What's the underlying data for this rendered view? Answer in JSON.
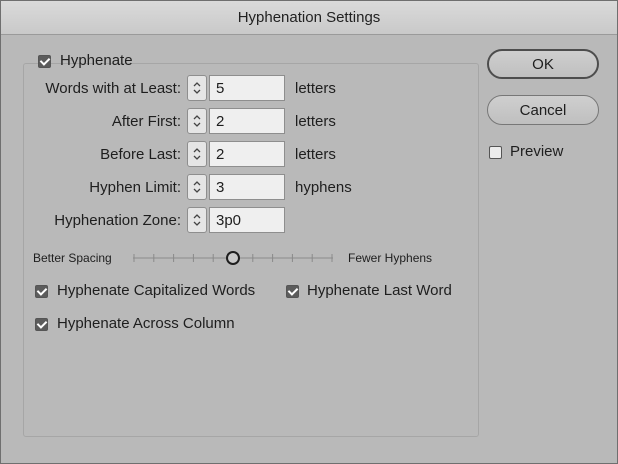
{
  "dialog": {
    "title": "Hyphenation Settings"
  },
  "hyphenate": {
    "label": "Hyphenate",
    "checked": true
  },
  "fields": [
    {
      "label": "Words with at Least:",
      "value": "5",
      "unit": "letters"
    },
    {
      "label": "After First:",
      "value": "2",
      "unit": "letters"
    },
    {
      "label": "Before Last:",
      "value": "2",
      "unit": "letters"
    },
    {
      "label": "Hyphen Limit:",
      "value": "3",
      "unit": "hyphens"
    },
    {
      "label": "Hyphenation Zone:",
      "value": "3p0",
      "unit": ""
    }
  ],
  "slider": {
    "left_label": "Better Spacing",
    "right_label": "Fewer Hyphens",
    "value_fraction": 0.5,
    "ticks": 11
  },
  "options": [
    {
      "label": "Hyphenate Capitalized Words",
      "checked": true
    },
    {
      "label": "Hyphenate Last Word",
      "checked": true
    },
    {
      "label": "Hyphenate Across Column",
      "checked": true
    }
  ],
  "buttons": {
    "ok": "OK",
    "cancel": "Cancel"
  },
  "preview": {
    "label": "Preview",
    "checked": false
  },
  "colors": {
    "dialog_bg": "#b9b9b9",
    "checkbox_checked": "#5c5c5c"
  },
  "icons": {
    "spinner": "up-down-chevron-icon",
    "checkmark": "checkmark-icon"
  }
}
